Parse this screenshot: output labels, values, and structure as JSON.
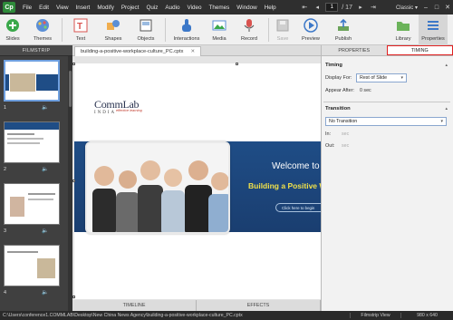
{
  "menubar": {
    "logo": "Cp",
    "items": [
      "File",
      "Edit",
      "View",
      "Insert",
      "Modify",
      "Project",
      "Quiz",
      "Audio",
      "Video",
      "Themes",
      "Window",
      "Help"
    ],
    "current_page": "1",
    "total_pages": "/ 17",
    "layout_mode": "Classic"
  },
  "toolbar": {
    "slides": "Slides",
    "themes": "Themes",
    "text": "Text",
    "shapes": "Shapes",
    "objects": "Objects",
    "interactions": "Interactions",
    "media": "Media",
    "record": "Record",
    "save": "Save",
    "preview": "Preview",
    "publish": "Publish",
    "library": "Library",
    "properties": "Properties"
  },
  "filmstrip": {
    "title": "FILMSTRIP",
    "slides": [
      {
        "number": "1"
      },
      {
        "number": "2"
      },
      {
        "number": "3"
      },
      {
        "number": "4"
      }
    ]
  },
  "document": {
    "tab_name": "building-a-positive-workplace-culture_PC.cptx"
  },
  "slide": {
    "logo_name": "CommLab",
    "logo_sub": "INDIA",
    "logo_tagline": "effective learning",
    "welcome": "Welcome to th",
    "building": "Building a Positive W",
    "click_button": "Click here to begin"
  },
  "bottom_tabs": {
    "timeline": "TIMELINE",
    "effects": "EFFECTS"
  },
  "right_panel": {
    "tabs": {
      "properties": "PROPERTIES",
      "timing": "TIMING"
    },
    "timing": {
      "title": "Timing",
      "display_for_label": "Display For:",
      "display_for_value": "Rest of Slide",
      "appear_after_label": "Appear After:",
      "appear_after_value": "0 sec"
    },
    "transition": {
      "title": "Transition",
      "value": "No Transition",
      "in_label": "In:",
      "in_value": "sec",
      "out_label": "Out:",
      "out_value": "sec"
    }
  },
  "statusbar": {
    "path": "C:\\Users\\conference1.COMMLAB\\Desktop\\New China News Agency\\building-a-positive-workplace-culture_PC.cptx",
    "view": "Filmstrip View",
    "size": "980 x 640"
  },
  "colors": {
    "accent_red": "#e02020",
    "slide_banner": "#1f4d86",
    "heading_yellow": "#f0e04a",
    "logo_green": "#2e8b3a"
  }
}
